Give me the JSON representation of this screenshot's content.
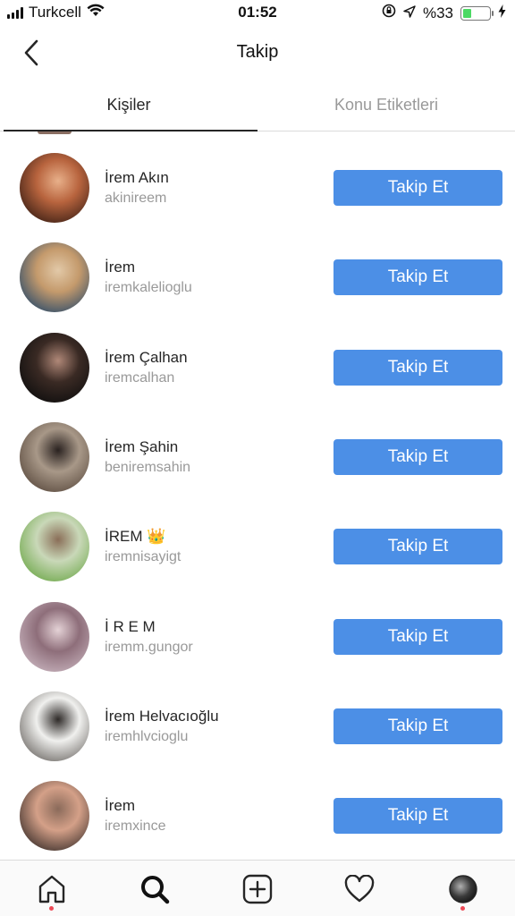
{
  "status_bar": {
    "carrier": "Turkcell",
    "time": "01:52",
    "battery_percent": "%33",
    "battery_level": 0.33
  },
  "nav": {
    "title": "Takip",
    "back_icon": "chevron-left-icon"
  },
  "tabs": [
    {
      "label": "Kişiler",
      "active": true
    },
    {
      "label": "Konu Etiketleri",
      "active": false
    }
  ],
  "users": [
    {
      "name": "İrem Akın",
      "username": "akinireem",
      "button": "Takip Et",
      "avatar_colors": [
        "#3a1e14",
        "#b8643e",
        "#e8b08a"
      ]
    },
    {
      "name": "İrem",
      "username": "iremkalelioglu",
      "button": "Takip Et",
      "avatar_colors": [
        "#2a4a6a",
        "#c49a6c",
        "#e2c9a8"
      ]
    },
    {
      "name": "İrem Çalhan",
      "username": "iremcalhan",
      "button": "Takip Et",
      "avatar_colors": [
        "#0d0d0d",
        "#3a2a24",
        "#b08878"
      ]
    },
    {
      "name": "İrem Şahin",
      "username": "beniremsahin",
      "button": "Takip Et",
      "avatar_colors": [
        "#5a4a3e",
        "#a89888",
        "#2a2220"
      ]
    },
    {
      "name": "İREM 👑",
      "username": "iremnisayigt",
      "button": "Takip Et",
      "avatar_colors": [
        "#6ea84a",
        "#c9d8b8",
        "#8a6e58"
      ]
    },
    {
      "name": "İ R E M",
      "username": "iremm.gungor",
      "button": "Takip Et",
      "avatar_colors": [
        "#c8b4be",
        "#8e6e7a",
        "#e4d2d6"
      ]
    },
    {
      "name": "İrem Helvacıoğlu",
      "username": "iremhlvcioglu",
      "button": "Takip Et",
      "avatar_colors": [
        "#6e6a66",
        "#f0f0ee",
        "#2e2a28"
      ]
    },
    {
      "name": "İrem",
      "username": "iremxince",
      "button": "Takip Et",
      "avatar_colors": [
        "#3a2e2a",
        "#d4a088",
        "#8a6a5a"
      ]
    }
  ],
  "tab_bar": {
    "items": [
      {
        "icon": "home-icon",
        "badge": true
      },
      {
        "icon": "search-icon",
        "badge": false
      },
      {
        "icon": "add-post-icon",
        "badge": false
      },
      {
        "icon": "heart-icon",
        "badge": false
      },
      {
        "icon": "profile-avatar-icon",
        "badge": true
      }
    ]
  },
  "colors": {
    "follow_button": "#4c8fe6",
    "secondary_text": "#999999",
    "badge": "#ed4956"
  }
}
